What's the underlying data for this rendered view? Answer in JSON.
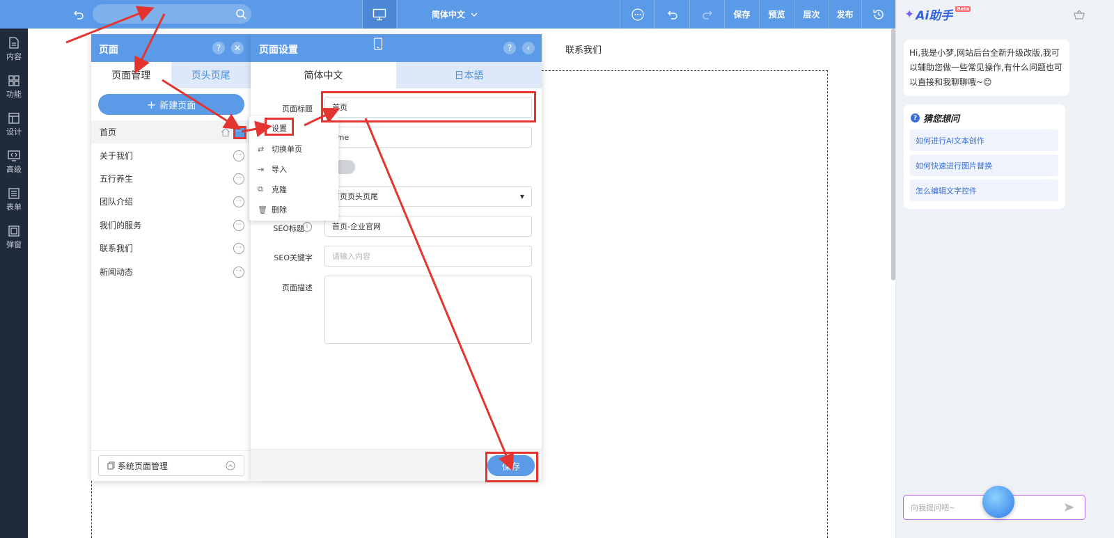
{
  "topbar": {
    "language": "简体中文",
    "save": "保存",
    "preview": "预览",
    "layers": "层次",
    "publish": "发布"
  },
  "rail": [
    {
      "label": "内容",
      "icon": "document-icon"
    },
    {
      "label": "功能",
      "icon": "grid-icon"
    },
    {
      "label": "设计",
      "icon": "layout-icon"
    },
    {
      "label": "高级",
      "icon": "code-icon"
    },
    {
      "label": "表单",
      "icon": "form-icon"
    },
    {
      "label": "弹窗",
      "icon": "popup-icon"
    }
  ],
  "canvas": {
    "nav_item": "联系我们"
  },
  "pages_panel": {
    "title": "页面",
    "tabs": [
      "页面管理",
      "页头页尾"
    ],
    "new_page": "新建页面",
    "pages": [
      "首页",
      "关于我们",
      "五行养生",
      "团队介绍",
      "我们的服务",
      "联系我们",
      "新闻动态"
    ],
    "system_pages": "系统页面管理"
  },
  "context_menu": [
    "设置",
    "切换单页",
    "导入",
    "克隆",
    "删除"
  ],
  "settings_panel": {
    "title": "页面设置",
    "tabs": [
      "简体中文",
      "日本語"
    ],
    "page_title_label": "页面标题",
    "page_title_value": "首页",
    "url_value": "ome",
    "header_footer_value": "首页页头页尾",
    "seo_title_label": "SEO标题",
    "seo_title_value": "首页-企业官网",
    "seo_keywords_label": "SEO关键字",
    "seo_keywords_placeholder": "请输入内容",
    "description_label": "页面描述",
    "save": "保存"
  },
  "ai_panel": {
    "title": "Ai助手",
    "beta": "Beta",
    "greeting": "Hi,我是小梦,网站后台全新升级改版,我可以辅助您做一些常见操作,有什么问题也可以直接和我聊聊哦~😊",
    "guess_title": "猜您想问",
    "suggestions": [
      "如何进行AI文本创作",
      "如何快速进行图片替换",
      "怎么编辑文字控件"
    ],
    "input_placeholder": "向我提问吧~"
  },
  "colors": {
    "primary": "#5b9ae6",
    "rail": "#1f2a3b",
    "annotation": "#e3342f"
  }
}
